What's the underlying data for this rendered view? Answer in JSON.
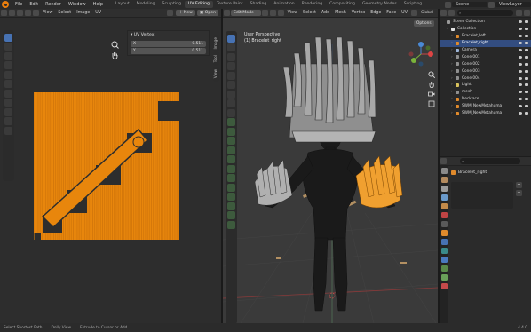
{
  "menu": [
    "File",
    "Edit",
    "Render",
    "Window",
    "Help"
  ],
  "workspaces": [
    "Layout",
    "Modeling",
    "Sculpting",
    "UV Editing",
    "Texture Paint",
    "Shading",
    "Animation",
    "Rendering",
    "Compositing",
    "Geometry Nodes",
    "Scripting"
  ],
  "active_workspace_index": 3,
  "scene": "Scene",
  "view_layer": "ViewLayer",
  "uv_editor": {
    "menus": [
      "View",
      "Select",
      "Image",
      "UV"
    ],
    "new_label": "New",
    "open_label": "Open",
    "panel_title": "UV Vertex",
    "fields": [
      {
        "axis": "X",
        "value": "0.511"
      },
      {
        "axis": "Y",
        "value": "0.511"
      }
    ],
    "side_tabs": [
      "Image",
      "Tool",
      "View"
    ]
  },
  "viewport": {
    "mode": "Edit Mode",
    "menus": [
      "View",
      "Select",
      "Add",
      "Mesh",
      "Vertex",
      "Edge",
      "Face",
      "UV"
    ],
    "orientation": "Global",
    "perspective_label": "User Perspective",
    "object_label": "(1) Bracelet_right",
    "options_label": "Options"
  },
  "outliner": {
    "search_placeholder": "",
    "items": [
      {
        "name": "Scene Collection",
        "indent": 0,
        "color": "#9a9a9a",
        "selected": false
      },
      {
        "name": "Collection",
        "indent": 1,
        "color": "#e0e0e0",
        "selected": false
      },
      {
        "name": "Bracelet_left",
        "indent": 2,
        "color": "#e08a2c",
        "selected": false
      },
      {
        "name": "Bracelet_right",
        "indent": 2,
        "color": "#e08a2c",
        "selected": true
      },
      {
        "name": "Camera",
        "indent": 2,
        "color": "#9bb3d6",
        "selected": false
      },
      {
        "name": "Cone.001",
        "indent": 2,
        "color": "#8f8f8f",
        "selected": false
      },
      {
        "name": "Cone.002",
        "indent": 2,
        "color": "#8f8f8f",
        "selected": false
      },
      {
        "name": "Cone.003",
        "indent": 2,
        "color": "#8f8f8f",
        "selected": false
      },
      {
        "name": "Cone.004",
        "indent": 2,
        "color": "#8f8f8f",
        "selected": false
      },
      {
        "name": "Light",
        "indent": 2,
        "color": "#d8c25c",
        "selected": false
      },
      {
        "name": "mesh",
        "indent": 2,
        "color": "#8f8f8f",
        "selected": false
      },
      {
        "name": "Necklace",
        "indent": 2,
        "color": "#e08a2c",
        "selected": false
      },
      {
        "name": "SWM_NewMetahuma",
        "indent": 2,
        "color": "#e08a2c",
        "selected": false
      },
      {
        "name": "SWM_NewMetahuma",
        "indent": 2,
        "color": "#e08a2c",
        "selected": false
      }
    ]
  },
  "properties": {
    "object_name": "Bracelet_right"
  },
  "status_bar": {
    "items": [
      "Select Shortest Path",
      "Dolly View",
      "Extrude to Cursor or Add"
    ],
    "version": "4.4.0"
  },
  "colors": {
    "accent_orange": "#e8860c",
    "selection_blue": "#4772b3",
    "mesh_gray": "#9a9a9a",
    "body_dark": "#1a1a1a"
  }
}
